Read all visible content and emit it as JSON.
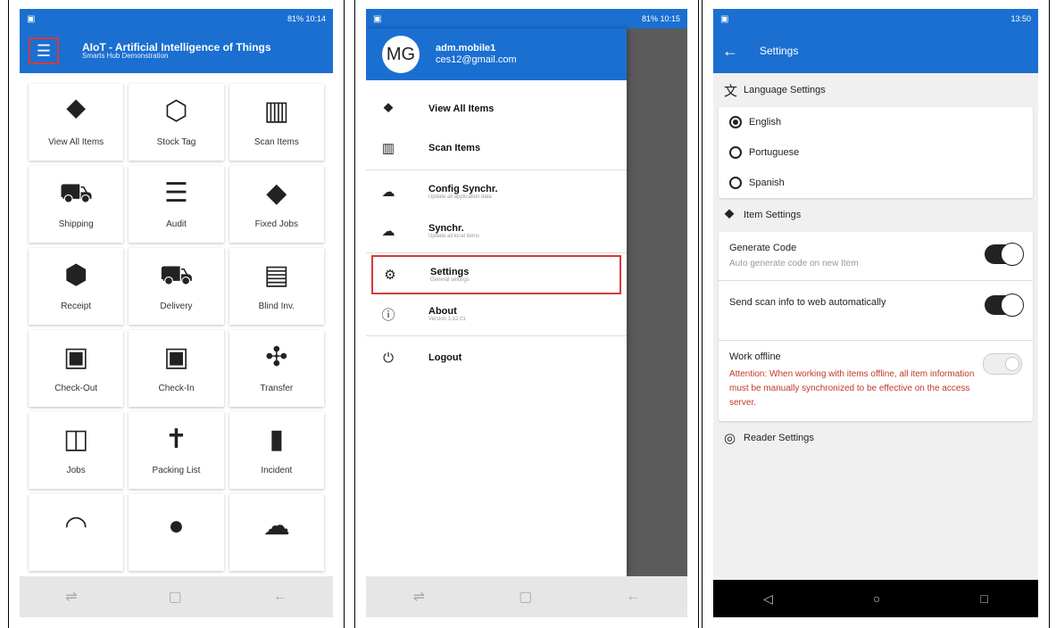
{
  "screen1": {
    "status": {
      "time": "10:14",
      "battery": "81%"
    },
    "title": "AIoT - Artificial Intelligence of Things",
    "subtitle": "Smarts Hub Demonstration",
    "tiles": [
      {
        "label": "View All Items",
        "icon": "⯁"
      },
      {
        "label": "Stock Tag",
        "icon": "⬡"
      },
      {
        "label": "Scan Items",
        "icon": "▥"
      },
      {
        "label": "Shipping",
        "icon": "⛟"
      },
      {
        "label": "Audit",
        "icon": "☰"
      },
      {
        "label": "Fixed Jobs",
        "icon": "◆"
      },
      {
        "label": "Receipt",
        "icon": "⬢"
      },
      {
        "label": "Delivery",
        "icon": "⛟"
      },
      {
        "label": "Blind Inv.",
        "icon": "▤"
      },
      {
        "label": "Check-Out",
        "icon": "▣"
      },
      {
        "label": "Check-In",
        "icon": "▣"
      },
      {
        "label": "Transfer",
        "icon": "✣"
      },
      {
        "label": "Jobs",
        "icon": "◫"
      },
      {
        "label": "Packing List",
        "icon": "✝"
      },
      {
        "label": "Incident",
        "icon": "▮"
      },
      {
        "label": "",
        "icon": "◠"
      },
      {
        "label": "",
        "icon": "●"
      },
      {
        "label": "",
        "icon": "☁"
      }
    ]
  },
  "screen2": {
    "status": {
      "time": "10:15",
      "battery": "81%"
    },
    "avatar": "MG",
    "username": "adm.mobile1",
    "email": "ces12@gmail.com",
    "items": [
      {
        "label": "View All Items",
        "sub": "",
        "icon": "⯁"
      },
      {
        "label": "Scan Items",
        "sub": "",
        "icon": "▥"
      },
      {
        "label": "Config Synchr.",
        "sub": "Update all application data",
        "icon": "☁"
      },
      {
        "label": "Synchr.",
        "sub": "Update all local items",
        "icon": "☁"
      },
      {
        "label": "Settings",
        "sub": "General settings",
        "icon": "⚙"
      },
      {
        "label": "About",
        "sub": "Version 1.12.01",
        "icon": "ⓘ"
      },
      {
        "label": "Logout",
        "sub": "",
        "icon": "⏻"
      }
    ]
  },
  "screen3": {
    "status": {
      "time": "13:50"
    },
    "title": "Settings",
    "language_header": "Language Settings",
    "languages": [
      {
        "label": "English",
        "selected": true
      },
      {
        "label": "Portuguese",
        "selected": false
      },
      {
        "label": "Spanish",
        "selected": false
      }
    ],
    "item_header": "Item Settings",
    "generate_code": "Generate Code",
    "generate_code_desc": "Auto generate code on new Item",
    "send_scan": "Send scan info to web automatically",
    "work_offline": "Work offline",
    "work_offline_warning": "Attention: When working with items offline, all item information must be manually synchronized to be effective on the access server.",
    "reader_header": "Reader Settings"
  },
  "colors": {
    "primary": "#1b6fd1",
    "highlight": "#d43b3b",
    "warning": "#c0392b"
  }
}
